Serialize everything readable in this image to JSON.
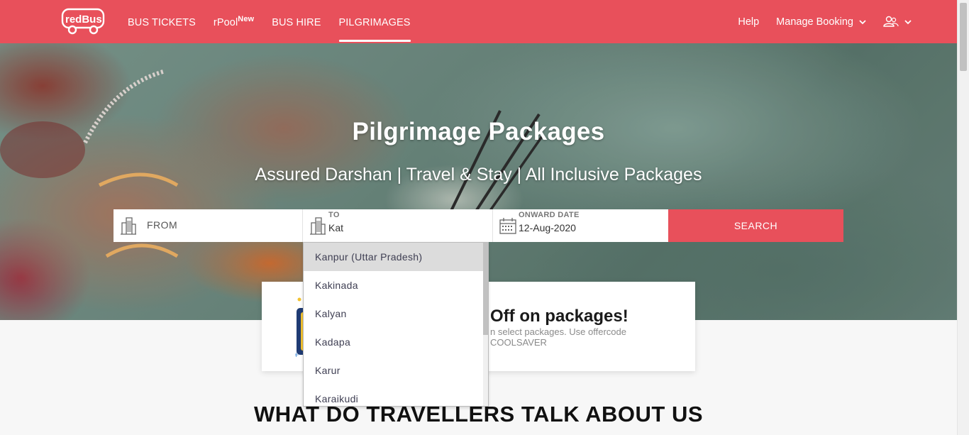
{
  "header": {
    "logo_text": "redBus",
    "nav": [
      {
        "label": "BUS TICKETS",
        "badge": ""
      },
      {
        "label": "rPool",
        "badge": "New"
      },
      {
        "label": "BUS HIRE",
        "badge": ""
      },
      {
        "label": "PILGRIMAGES",
        "badge": ""
      }
    ],
    "help": "Help",
    "manage_booking": "Manage Booking"
  },
  "hero": {
    "title": "Pilgrimage Packages",
    "subtitle": "Assured Darshan | Travel & Stay | All Inclusive Packages"
  },
  "search": {
    "from_placeholder": "FROM",
    "to_label": "TO",
    "to_value": "Kat",
    "date_label": "ONWARD DATE",
    "date_value": "12-Aug-2020",
    "button": "SEARCH"
  },
  "suggestions": [
    "Kanpur (Uttar Pradesh)",
    "Kakinada",
    "Kalyan",
    "Kadapa",
    "Karur",
    "Karaikudi"
  ],
  "offer": {
    "title": "Off on packages!",
    "line1": "n select packages. Use offercode",
    "line2": "COOLSAVER"
  },
  "section": {
    "title": "WHAT DO TRAVELLERS TALK ABOUT US"
  },
  "colors": {
    "brand": "#e8505b",
    "highlight": "#dcdcdc"
  }
}
